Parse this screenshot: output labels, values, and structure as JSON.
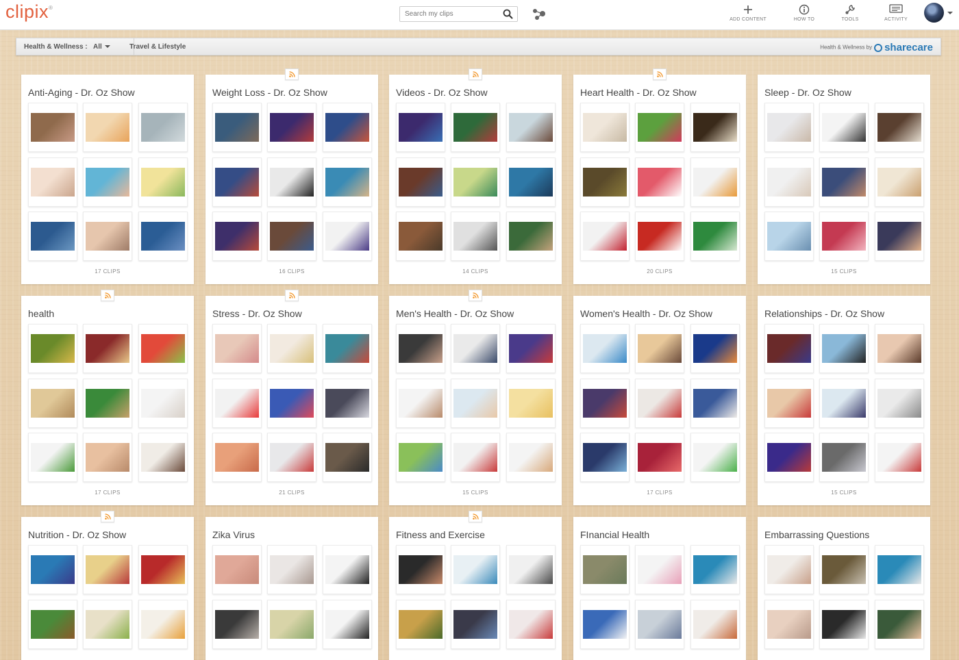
{
  "header": {
    "logo": "clipix",
    "logo_mark": "®",
    "search_placeholder": "Search my clips",
    "nav": [
      {
        "label": "ADD CONTENT",
        "icon": "plus-icon"
      },
      {
        "label": "HOW TO",
        "icon": "info-icon"
      },
      {
        "label": "TOOLS",
        "icon": "wrench-icon"
      },
      {
        "label": "ACTIVITY",
        "icon": "activity-icon"
      }
    ]
  },
  "subnav": {
    "category": "Health & Wellness :",
    "filter": "All",
    "tab2": "Travel & Lifestyle",
    "sponsor_text": "Health & Wellness by",
    "sponsor_brand": "sharecare"
  },
  "colors": {
    "brand": "#e2613f",
    "rss": "#f29322",
    "sharecare": "#2a79b5"
  },
  "boards": [
    {
      "title": "Anti-Aging - Dr. Oz Show",
      "count": "17 CLIPS",
      "rss": false,
      "thumbs": [
        [
          "#8f6a4c",
          "#c89a86"
        ],
        [
          "#f2d7b0",
          "#e8a35a"
        ],
        [
          "#a6b4ba",
          "#d2dadd"
        ],
        [
          "#f3dfd0",
          "#caa58c"
        ],
        [
          "#62b5d6",
          "#e8b89a"
        ],
        [
          "#f1e39a",
          "#8ab85c"
        ],
        [
          "#2c5a8f",
          "#6c98c2"
        ],
        [
          "#e6c6ad",
          "#9e7b67"
        ],
        [
          "#2b5d95",
          "#6b8fc2"
        ]
      ]
    },
    {
      "title": "Weight Loss - Dr. Oz Show",
      "count": "16 CLIPS",
      "rss": true,
      "thumbs": [
        [
          "#3a5c7c",
          "#7d6a5a"
        ],
        [
          "#3c2a6d",
          "#b33b3b"
        ],
        [
          "#2e4d8a",
          "#c8553b"
        ],
        [
          "#354d86",
          "#b84b3a"
        ],
        [
          "#e9e9e9",
          "#222222"
        ],
        [
          "#3a8bb5",
          "#d6b488"
        ],
        [
          "#3e2f6a",
          "#b74a3a"
        ],
        [
          "#6a4a3a",
          "#3b5b8c"
        ],
        [
          "#f2f2f2",
          "#4a3b86"
        ]
      ]
    },
    {
      "title": "Videos - Dr. Oz Show",
      "count": "14 CLIPS",
      "rss": true,
      "thumbs": [
        [
          "#3c2a6d",
          "#3a6fb5"
        ],
        [
          "#2e6a3a",
          "#b33b3b"
        ],
        [
          "#c9d7dd",
          "#6b4a3a"
        ],
        [
          "#6a3a2a",
          "#3a5c8c"
        ],
        [
          "#c8d88a",
          "#3a8a5a"
        ],
        [
          "#2e78a6",
          "#1c3a5a"
        ],
        [
          "#8a5a3a",
          "#4a3a2a"
        ],
        [
          "#e0e0e0",
          "#555555"
        ],
        [
          "#3b6a3a",
          "#c4a27c"
        ]
      ]
    },
    {
      "title": "Heart Health - Dr. Oz Show",
      "count": "20 CLIPS",
      "rss": true,
      "thumbs": [
        [
          "#efe6da",
          "#c7b9a3"
        ],
        [
          "#5ca03e",
          "#d23a5c"
        ],
        [
          "#3a2a1a",
          "#e8ddc8"
        ],
        [
          "#5a4a2a",
          "#8a7a3a"
        ],
        [
          "#e35a6a",
          "#ffffff"
        ],
        [
          "#f2f2f2",
          "#e89a3a"
        ],
        [
          "#f2f2f2",
          "#c2212f"
        ],
        [
          "#c72a22",
          "#ffffff"
        ],
        [
          "#2e8a3e",
          "#d7e8d2"
        ]
      ]
    },
    {
      "title": "Sleep - Dr. Oz Show",
      "count": "15 CLIPS",
      "rss": false,
      "thumbs": [
        [
          "#e8e8ea",
          "#c9b8a8"
        ],
        [
          "#f4f4f4",
          "#333333"
        ],
        [
          "#5a4030",
          "#e5ddd0"
        ],
        [
          "#f0f0f0",
          "#d8c8b8"
        ],
        [
          "#3b4d7a",
          "#c28a6a"
        ],
        [
          "#f0e6d4",
          "#caa070"
        ],
        [
          "#b8d4e8",
          "#6a8fb0"
        ],
        [
          "#c43a52",
          "#f2b5c0"
        ],
        [
          "#3a3a5a",
          "#e0b08a"
        ]
      ]
    },
    {
      "title": "health",
      "count": "17 CLIPS",
      "rss": true,
      "thumbs": [
        [
          "#6a8a2a",
          "#d8b84a"
        ],
        [
          "#8a2a2a",
          "#e8c88a"
        ],
        [
          "#e24a3a",
          "#8ac24a"
        ],
        [
          "#e0c898",
          "#b08a5a"
        ],
        [
          "#3a8a3a",
          "#c8a06a"
        ],
        [
          "#f4f4f4",
          "#d8d0c8"
        ],
        [
          "#f4f4f4",
          "#4a9a3a"
        ],
        [
          "#e8c0a0",
          "#b88a6a"
        ],
        [
          "#f0ece6",
          "#6a4a3a"
        ]
      ]
    },
    {
      "title": "Stress - Dr. Oz Show",
      "count": "21 CLIPS",
      "rss": true,
      "thumbs": [
        [
          "#e8c8b8",
          "#d48a8a"
        ],
        [
          "#f2eae0",
          "#d8c07a"
        ],
        [
          "#3a8a9a",
          "#c84a3a"
        ],
        [
          "#f2f2f2",
          "#e83a3a"
        ],
        [
          "#3a5ab5",
          "#e04a5a"
        ],
        [
          "#4a4a5a",
          "#d8d8e0"
        ],
        [
          "#e8a07a",
          "#c86a4a"
        ],
        [
          "#e8e8ea",
          "#c83a3a"
        ],
        [
          "#6a5a4a",
          "#2a2a2a"
        ]
      ]
    },
    {
      "title": "Men's Health - Dr. Oz Show",
      "count": "15 CLIPS",
      "rss": true,
      "thumbs": [
        [
          "#3a3a3a",
          "#c8a08a"
        ],
        [
          "#eaeaea",
          "#3a4a6a"
        ],
        [
          "#4a3a8a",
          "#c83a3a"
        ],
        [
          "#f4f4f4",
          "#b88a6a"
        ],
        [
          "#dce8f0",
          "#e8c8a8"
        ],
        [
          "#f4e0a0",
          "#e8c060"
        ],
        [
          "#8ac05a",
          "#4a8ac8"
        ],
        [
          "#f2f2f2",
          "#c83a3a"
        ],
        [
          "#f4f4f4",
          "#d8a87a"
        ]
      ]
    },
    {
      "title": "Women's Health - Dr. Oz Show",
      "count": "17 CLIPS",
      "rss": false,
      "thumbs": [
        [
          "#dce8f0",
          "#3a8ac8"
        ],
        [
          "#e8c89a",
          "#6a4a3a"
        ],
        [
          "#1a3a8a",
          "#e88a3a"
        ],
        [
          "#4a3a6a",
          "#c84a3a"
        ],
        [
          "#ece8e4",
          "#c83a3a"
        ],
        [
          "#3a5a9a",
          "#f0ece8"
        ],
        [
          "#2a3a6a",
          "#7ab0d8"
        ],
        [
          "#a8223a",
          "#e86a6a"
        ],
        [
          "#f4f4f4",
          "#4ab04a"
        ]
      ]
    },
    {
      "title": "Relationships - Dr. Oz Show",
      "count": "15 CLIPS",
      "rss": false,
      "thumbs": [
        [
          "#6a2a2a",
          "#3a3a8a"
        ],
        [
          "#8ab8d8",
          "#222222"
        ],
        [
          "#e8c8b0",
          "#5a3a2a"
        ],
        [
          "#e8c8a8",
          "#c83a3a"
        ],
        [
          "#dce8f0",
          "#3a3a6a"
        ],
        [
          "#eaeaea",
          "#8a8a8a"
        ],
        [
          "#3a2a8a",
          "#b83a3a"
        ],
        [
          "#6a6a6a",
          "#c8c8d0"
        ],
        [
          "#f4f4f4",
          "#c83a3a"
        ]
      ]
    },
    {
      "title": "Nutrition - Dr. Oz Show",
      "count": "",
      "rss": true,
      "thumbs": [
        [
          "#2a7ab5",
          "#3a3a8a"
        ],
        [
          "#e8d08a",
          "#b83a3a"
        ],
        [
          "#b82a2a",
          "#e8c05a"
        ],
        [
          "#4a8a3a",
          "#8a5a2a"
        ],
        [
          "#e8e0c8",
          "#8ab04a"
        ],
        [
          "#f4f0e8",
          "#e8a03a"
        ],
        [
          "#f2f2f2",
          "#f2f2f2"
        ],
        [
          "#f2f2f2",
          "#f2f2f2"
        ],
        [
          "#f2f2f2",
          "#f2f2f2"
        ]
      ]
    },
    {
      "title": "Zika Virus",
      "count": "",
      "rss": false,
      "thumbs": [
        [
          "#e0a898",
          "#c88a7a"
        ],
        [
          "#eae6e4",
          "#a89890"
        ],
        [
          "#f4f4f4",
          "#222222"
        ],
        [
          "#3a3a3a",
          "#b8b0aa"
        ],
        [
          "#d8d4a8",
          "#8aa86a"
        ],
        [
          "#f4f4f4",
          "#222222"
        ],
        [
          "#f2f2f2",
          "#f2f2f2"
        ],
        [
          "#f2f2f2",
          "#f2f2f2"
        ],
        [
          "#f2f2f2",
          "#f2f2f2"
        ]
      ]
    },
    {
      "title": "Fitness and Exercise",
      "count": "",
      "rss": true,
      "thumbs": [
        [
          "#2a2a2a",
          "#c88a6a"
        ],
        [
          "#e8f0f4",
          "#3a8aba"
        ],
        [
          "#f0f0f0",
          "#4a4a4a"
        ],
        [
          "#c8a04a",
          "#4a6a2a"
        ],
        [
          "#3a3a4a",
          "#6a8ab8"
        ],
        [
          "#f0e8e8",
          "#c83a3a"
        ],
        [
          "#f2f2f2",
          "#f2f2f2"
        ],
        [
          "#f2f2f2",
          "#f2f2f2"
        ],
        [
          "#f2f2f2",
          "#f2f2f2"
        ]
      ]
    },
    {
      "title": "FInancial Health",
      "count": "",
      "rss": false,
      "thumbs": [
        [
          "#8a8a6a",
          "#6a7a5a"
        ],
        [
          "#f4f4f4",
          "#e8a0b8"
        ],
        [
          "#2a8ab8",
          "#e8e8e8"
        ],
        [
          "#3a6ab8",
          "#f4f4f4"
        ],
        [
          "#c8d0d8",
          "#6a7a9a"
        ],
        [
          "#f0ece8",
          "#c86a3a"
        ],
        [
          "#f2f2f2",
          "#f2f2f2"
        ],
        [
          "#f2f2f2",
          "#f2f2f2"
        ],
        [
          "#f2f2f2",
          "#f2f2f2"
        ]
      ]
    },
    {
      "title": "Embarrassing Questions",
      "count": "",
      "rss": false,
      "thumbs": [
        [
          "#f0ece8",
          "#c8a08a"
        ],
        [
          "#6a5a3a",
          "#c8c0b0"
        ],
        [
          "#2a8ab8",
          "#e8e8e8"
        ],
        [
          "#e8d0c0",
          "#b89a8a"
        ],
        [
          "#2a2a2a",
          "#e8e8e8"
        ],
        [
          "#3a5a3a",
          "#e8c0a0"
        ],
        [
          "#f2f2f2",
          "#f2f2f2"
        ],
        [
          "#f2f2f2",
          "#f2f2f2"
        ],
        [
          "#f2f2f2",
          "#f2f2f2"
        ]
      ]
    }
  ]
}
